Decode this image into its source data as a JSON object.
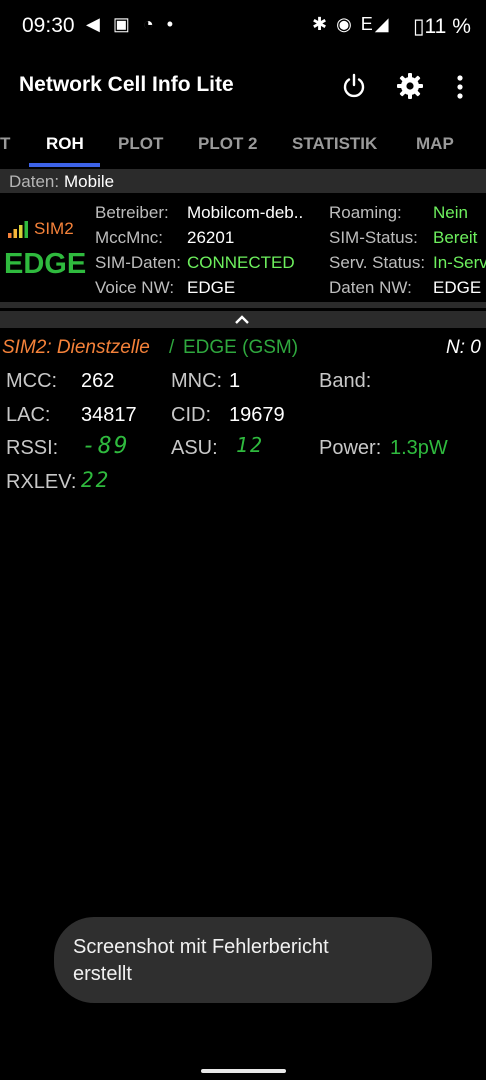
{
  "status_bar": {
    "time": "09:30",
    "left_icons": "◀ ▣ ◔ •",
    "right_icons": "✱ ◉ E◢",
    "battery": "▯11 %"
  },
  "app_bar": {
    "title": "Network Cell Info Lite",
    "icons": [
      "power-icon",
      "gear-icon",
      "more-vert-icon"
    ]
  },
  "tabs": [
    {
      "label": "T"
    },
    {
      "label": "ROH",
      "active": true
    },
    {
      "label": "PLOT"
    },
    {
      "label": "PLOT 2"
    },
    {
      "label": "STATISTIK"
    },
    {
      "label": "MAP"
    }
  ],
  "data_row": {
    "label": "Daten:",
    "value": "Mobile"
  },
  "sim": {
    "label": "SIM2",
    "technology": "EDGE",
    "colors": {
      "sim_label": "#f5823a",
      "technology": "#2fba3e",
      "value_green": "#6ef05e"
    },
    "left_fields": [
      {
        "key": "Betreiber:",
        "value": "Mobilcom-deb.."
      },
      {
        "key": "MccMnc:",
        "value": "26201"
      },
      {
        "key": "SIM-Daten:",
        "value": "CONNECTED"
      },
      {
        "key": "Voice NW:",
        "value": "EDGE"
      }
    ],
    "right_fields": [
      {
        "key": "Roaming:",
        "value": "Nein"
      },
      {
        "key": "SIM-Status:",
        "value": "Bereit"
      },
      {
        "key": "Serv. Status:",
        "value": "In-Serv"
      },
      {
        "key": "Daten NW:",
        "value": "EDGE"
      }
    ]
  },
  "serving_cell": {
    "title": "SIM2: Dienstzelle",
    "separator": "/",
    "technology": "EDGE (GSM)",
    "neighbors": "N: 0",
    "mcc_label": "MCC:",
    "mcc": "262",
    "mnc_label": "MNC:",
    "mnc": "1",
    "band_label": "Band:",
    "lac_label": "LAC:",
    "lac": "34817",
    "cid_label": "CID:",
    "cid": "19679",
    "rssi_label": "RSSI:",
    "rssi": "-89",
    "asu_label": "ASU:",
    "asu": "12",
    "power_label": "Power:",
    "power": "1.3pW",
    "rxlev_label": "RXLEV:",
    "rxlev": "22"
  },
  "toast": {
    "text": "Screenshot mit Fehlerbericht erstellt"
  }
}
